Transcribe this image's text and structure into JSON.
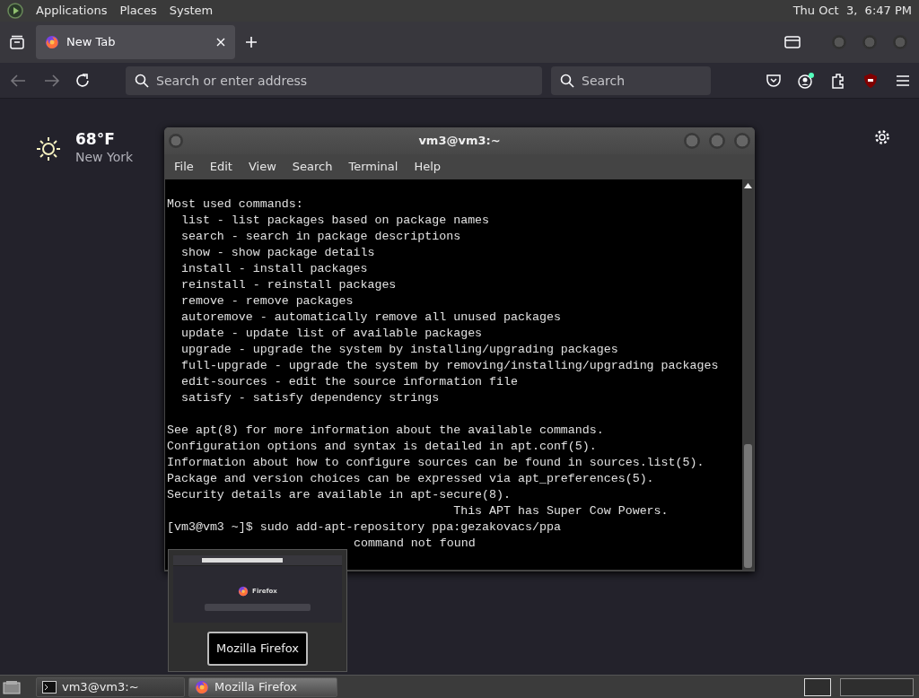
{
  "top_panel": {
    "menus": [
      "Applications",
      "Places",
      "System"
    ],
    "clock": "Thu Oct  3,  6:47 PM"
  },
  "browser": {
    "tabs": [
      {
        "label": "New Tab",
        "selected": true
      }
    ],
    "address": {
      "placeholder": "Search or enter address"
    },
    "search": {
      "placeholder": "Search"
    }
  },
  "new_tab_page": {
    "weather": {
      "temperature": "68°F",
      "location": "New York"
    }
  },
  "terminal": {
    "title": "vm3@vm3:~",
    "menu": [
      "File",
      "Edit",
      "View",
      "Search",
      "Terminal",
      "Help"
    ],
    "blocks": [
      [
        "Most used commands:",
        "  list - list packages based on package names",
        "  search - search in package descriptions",
        "  show - show package details",
        "  install - install packages",
        "  reinstall - reinstall packages",
        "  remove - remove packages",
        "  autoremove - automatically remove all unused packages",
        "  update - update list of available packages",
        "  upgrade - upgrade the system by installing/upgrading packages",
        "  full-upgrade - upgrade the system by removing/installing/upgrading packages",
        "  edit-sources - edit the source information file",
        "  satisfy - satisfy dependency strings"
      ],
      [
        "See apt(8) for more information about the available commands.",
        "Configuration options and syntax is detailed in apt.conf(5).",
        "Information about how to configure sources can be found in sources.list(5).",
        "Package and version choices can be expressed via apt_preferences(5).",
        "Security details are available in apt-secure(8).",
        "                                        This APT has Super Cow Powers.",
        "[vm3@vm3 ~]$ sudo add-apt-repository ppa:gezakovacs/ppa"
      ]
    ],
    "tail": "command not found"
  },
  "thumbnail_popup": {
    "thumb_text": "Firefox",
    "label": "Mozilla Firefox"
  },
  "taskbar": {
    "buttons": [
      {
        "label": "vm3@vm3:~",
        "kind": "terminal",
        "selected": false
      },
      {
        "label": "Mozilla Firefox",
        "kind": "browser",
        "selected": true
      }
    ]
  }
}
